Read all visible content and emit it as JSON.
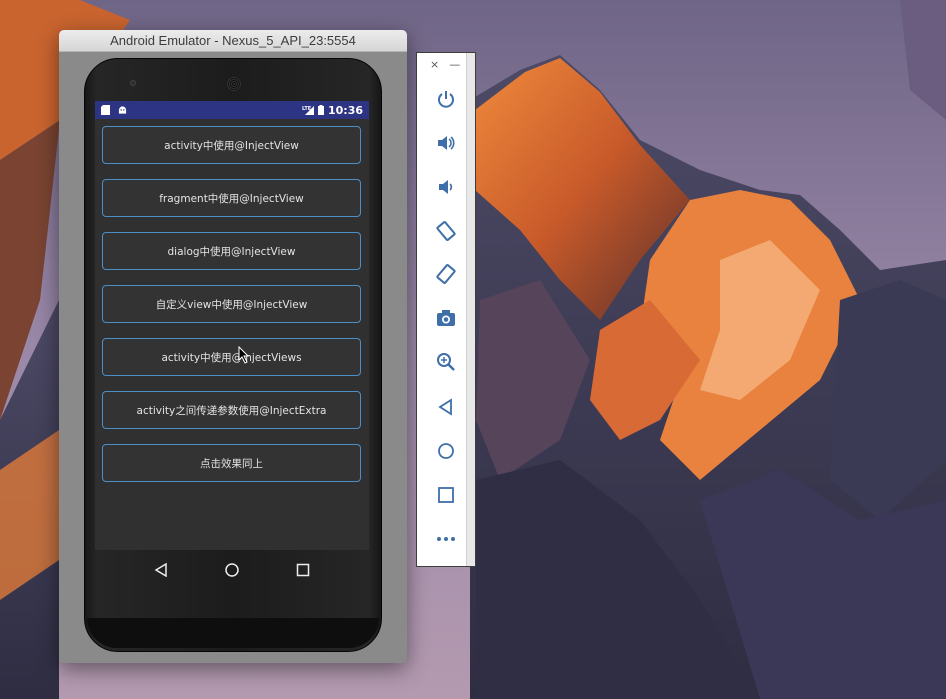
{
  "window": {
    "title": "Android Emulator - Nexus_5_API_23:5554"
  },
  "statusbar": {
    "time": "10:36",
    "left_icons": [
      "sd-card-icon",
      "android-icon"
    ],
    "right_icons": [
      "lte-signal-icon",
      "battery-icon"
    ]
  },
  "app": {
    "buttons": [
      {
        "label": "activity中使用@InjectView"
      },
      {
        "label": "fragment中使用@InjectView"
      },
      {
        "label": "dialog中使用@InjectView"
      },
      {
        "label": "自定义view中使用@InjectView"
      },
      {
        "label": "activity中使用@InjectViews"
      },
      {
        "label": "activity之间传递参数使用@InjectExtra"
      },
      {
        "label": "点击效果同上"
      }
    ]
  },
  "navbar": {
    "icons": [
      "back-icon",
      "home-icon",
      "recents-icon"
    ]
  },
  "toolbar": {
    "window_controls": {
      "close": "×",
      "minimize": "—"
    },
    "buttons": [
      "power-icon",
      "volume-up-icon",
      "volume-down-icon",
      "rotate-left-icon",
      "rotate-right-icon",
      "camera-icon",
      "zoom-icon",
      "back-icon",
      "home-icon",
      "overview-icon",
      "more-icon"
    ]
  },
  "colors": {
    "statusbar": "#2c3483",
    "button_border": "#4c8ec7",
    "screen_bg": "#303030",
    "toolbar_icon": "#3f6fa8"
  }
}
